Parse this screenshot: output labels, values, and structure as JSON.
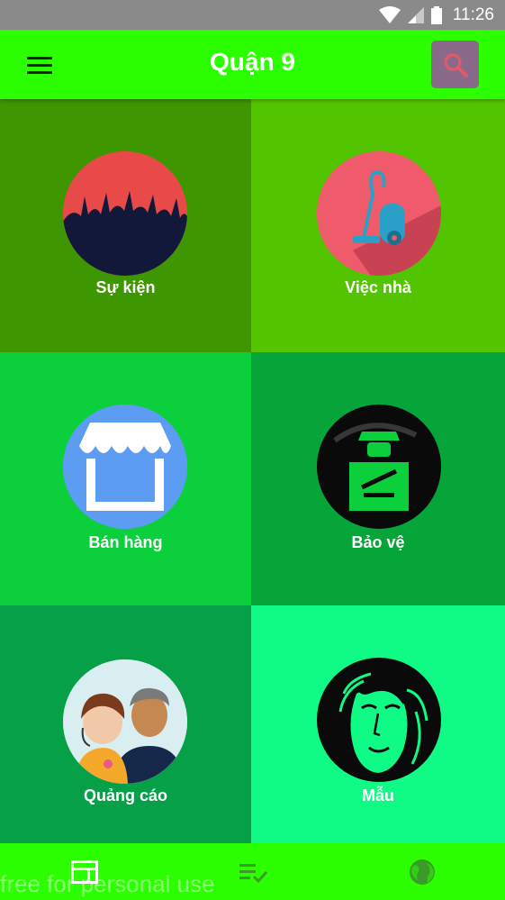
{
  "status_bar": {
    "time": "11:26",
    "icons": [
      "wifi-icon",
      "signal-icon",
      "battery-icon"
    ]
  },
  "app_bar": {
    "title": "Quận 9",
    "menu_icon": "menu-icon",
    "search_icon": "search-icon"
  },
  "tiles": [
    {
      "label": "Sự kiện",
      "bg": "#3e9600",
      "icon": "concert-crowd-icon"
    },
    {
      "label": "Việc nhà",
      "bg": "#53c400",
      "icon": "vacuum-cleaner-icon"
    },
    {
      "label": "Bán hàng",
      "bg": "#0bd03b",
      "icon": "storefront-icon"
    },
    {
      "label": "Bảo vệ",
      "bg": "#05a53a",
      "icon": "security-guard-icon"
    },
    {
      "label": "Quảng cáo",
      "bg": "#06a049",
      "icon": "support-agents-icon"
    },
    {
      "label": "Mẫu",
      "bg": "#10fb86",
      "icon": "model-face-icon"
    }
  ],
  "bottom_nav": {
    "items": [
      "web-panels-icon",
      "playlist-check-icon",
      "globe-icon"
    ],
    "watermark": "free for personal use"
  }
}
